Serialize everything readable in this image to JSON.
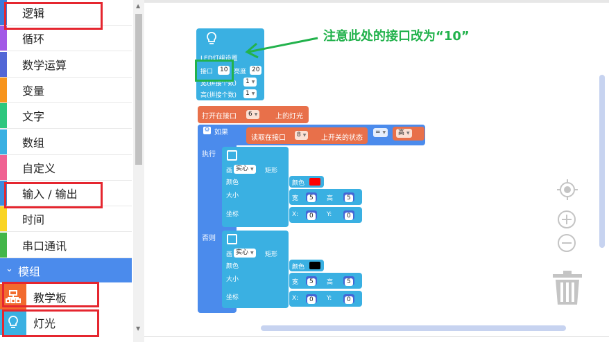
{
  "sidebar": {
    "categories": [
      {
        "label": "逻辑",
        "color": "#3b7bdc"
      },
      {
        "label": "循环",
        "color": "#a259e6"
      },
      {
        "label": "数学运算",
        "color": "#5266d6"
      },
      {
        "label": "变量",
        "color": "#f7941d"
      },
      {
        "label": "文字",
        "color": "#2ec77e"
      },
      {
        "label": "数组",
        "color": "#3ab0e2"
      },
      {
        "label": "自定义",
        "color": "#f06292"
      },
      {
        "label": "输入 / 输出",
        "color": "#3a8dde"
      },
      {
        "label": "时间",
        "color": "#f9d423"
      },
      {
        "label": "串口通讯",
        "color": "#43b649"
      }
    ],
    "modules_header": "模组",
    "modules": [
      {
        "label": "教学板",
        "icon": "board-icon",
        "color": "#f26a2e"
      },
      {
        "label": "灯光",
        "icon": "lightbulb-icon",
        "color": "#3ab0e2"
      }
    ]
  },
  "annotation": "注意此处的接口改为“10”",
  "blocks": {
    "led": {
      "title": "LED灯组设置",
      "port_label": "接口",
      "port_value": "10",
      "brightness_label": "亮度",
      "brightness_value": "20",
      "width_label": "宽(拼接个数)",
      "width_value": "1",
      "height_label": "高(拼接个数)",
      "height_value": "1"
    },
    "open_port": {
      "label": "打开在接口",
      "value": "6",
      "suffix": "上的灯光"
    },
    "if": {
      "if_label": "如果",
      "read_label": "读取在接口",
      "read_value": "8",
      "read_suffix": "上开关的状态",
      "op": "=",
      "high": "高",
      "then_label": "执行",
      "else_label": "否则"
    },
    "rect_then": {
      "draw": "画",
      "mode": "实心",
      "shape": "矩形",
      "color_label": "颜色",
      "color_word": "颜色",
      "color_value": "#ff0000",
      "size_label": "大小",
      "w_label": "宽",
      "w_value": "5",
      "h_label": "高",
      "h_value": "5",
      "pos_label": "坐标",
      "x_label": "X:",
      "x_value": "0",
      "y_label": "Y:",
      "y_value": "0"
    },
    "rect_else": {
      "draw": "画",
      "mode": "实心",
      "shape": "矩形",
      "color_label": "颜色",
      "color_word": "颜色",
      "color_value": "#000000",
      "size_label": "大小",
      "w_label": "宽",
      "w_value": "5",
      "h_label": "高",
      "h_value": "5",
      "pos_label": "坐标",
      "x_label": "X:",
      "x_value": "0",
      "y_label": "Y:",
      "y_value": "0"
    }
  }
}
